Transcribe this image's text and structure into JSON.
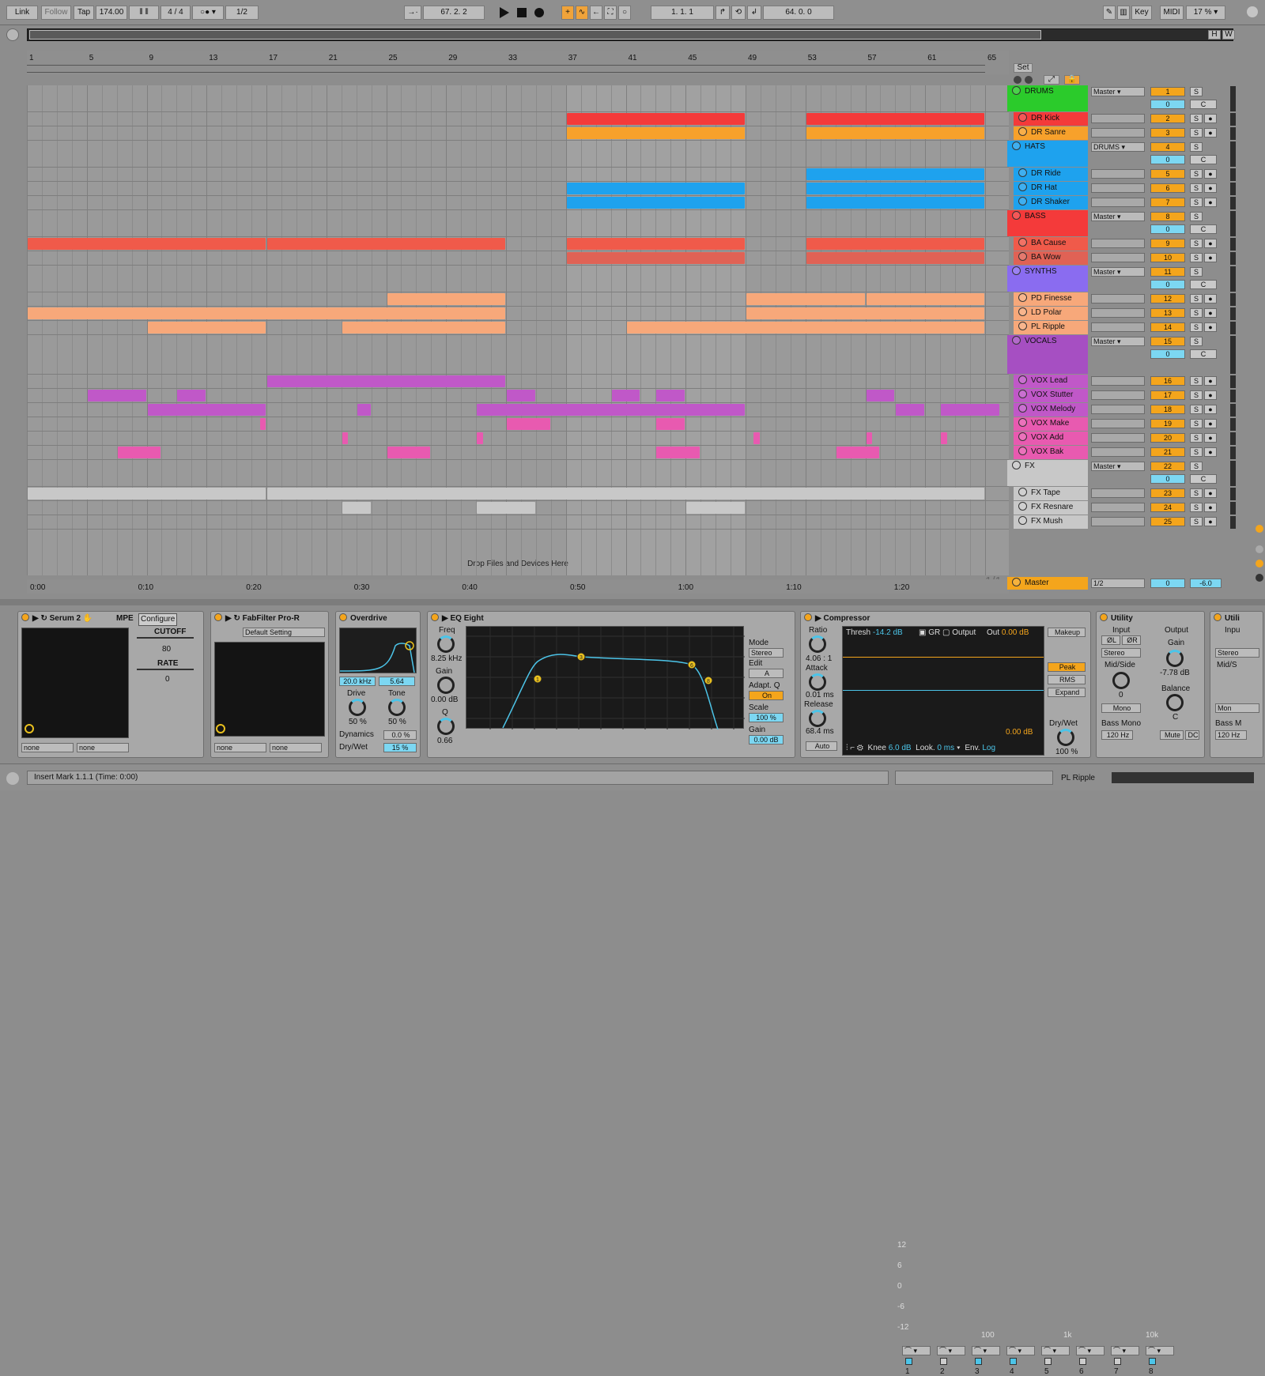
{
  "transport": {
    "link": "Link",
    "follow": "Follow",
    "tap": "Tap",
    "tempo": "174.00",
    "time_sig": "4 / 4",
    "quant": "1/2",
    "arr_pos": "67.  2.  2",
    "loop_start": "1.   1.   1",
    "loop_len": "64.   0.   0",
    "key": "Key",
    "midi": "MIDI",
    "cpu": "17 %",
    "h": "H",
    "w": "W",
    "set": "Set"
  },
  "ruler": [
    "1",
    "5",
    "9",
    "13",
    "17",
    "21",
    "25",
    "29",
    "33",
    "37",
    "41",
    "45",
    "49",
    "53",
    "57",
    "61",
    "65"
  ],
  "timeline": [
    "0:00",
    "0:10",
    "0:20",
    "0:30",
    "0:40",
    "0:50",
    "1:00",
    "1:10",
    "1:20"
  ],
  "arrangement": {
    "drop_text": "Drop Files and Devices Here",
    "page": "1/1"
  },
  "tracks": [
    {
      "name": "DRUMS",
      "color": "#2bcb2b",
      "group": true,
      "route": "Master",
      "n": "1"
    },
    {
      "name": "DR Kick",
      "color": "#f43a3a",
      "n": "2"
    },
    {
      "name": "DR Sanre",
      "color": "#f7a12b",
      "n": "3"
    },
    {
      "name": "HATS",
      "color": "#1ea2ee",
      "group": true,
      "route": "DRUMS",
      "n": "4"
    },
    {
      "name": "DR Ride",
      "color": "#1ea2ee",
      "n": "5"
    },
    {
      "name": "DR Hat",
      "color": "#1ea2ee",
      "n": "6"
    },
    {
      "name": "DR Shaker",
      "color": "#1ea2ee",
      "n": "7"
    },
    {
      "name": "BASS",
      "color": "#f43a3a",
      "group": true,
      "route": "Master",
      "n": "8"
    },
    {
      "name": "BA Cause",
      "color": "#f05a4a",
      "n": "9"
    },
    {
      "name": "BA Wow",
      "color": "#e06255",
      "n": "10"
    },
    {
      "name": "SYNTHS",
      "color": "#8a6cf0",
      "group": true,
      "route": "Master",
      "n": "11"
    },
    {
      "name": "PD Finesse",
      "color": "#f7a87a",
      "n": "12"
    },
    {
      "name": "LD Polar",
      "color": "#f7a87a",
      "n": "13"
    },
    {
      "name": "PL Ripple",
      "color": "#f7a87a",
      "n": "14"
    },
    {
      "name": "VOCALS",
      "color": "#a64fc2",
      "group": true,
      "route": "Master",
      "n": "15"
    },
    {
      "name": "VOX Lead",
      "color": "#c058c8",
      "n": "16"
    },
    {
      "name": "VOX Stutter",
      "color": "#c058c8",
      "n": "17"
    },
    {
      "name": "VOX Melody",
      "color": "#c058c8",
      "n": "18"
    },
    {
      "name": "VOX Make",
      "color": "#e85ab0",
      "n": "19"
    },
    {
      "name": "VOX Add",
      "color": "#e85ab0",
      "n": "20"
    },
    {
      "name": "VOX Bak",
      "color": "#e85ab0",
      "n": "21"
    },
    {
      "name": "FX",
      "color": "#c8c8c8",
      "group": true,
      "route": "Master",
      "n": "22"
    },
    {
      "name": "FX Tape",
      "color": "#c8c8c8",
      "n": "23"
    },
    {
      "name": "FX Resnare",
      "color": "#c8c8c8",
      "n": "24"
    },
    {
      "name": "FX Mush",
      "color": "#c8c8c8",
      "n": "25"
    }
  ],
  "master": {
    "name": "Master",
    "route": "1/2",
    "vol": "0",
    "pan": "-6.0"
  },
  "mixer_labels": {
    "solo": "S",
    "center": "C",
    "zero": "0"
  },
  "devices": {
    "serum": {
      "name": "Serum 2",
      "mpe": "MPE",
      "configure": "Configure",
      "cutoff": "CUTOFF",
      "cutoff_val": "80",
      "rate": "RATE",
      "rate_val": "0",
      "sel1": "none",
      "sel2": "none"
    },
    "fabfilter": {
      "name": "FabFilter Pro-R",
      "preset": "Default Setting",
      "sel1": "none",
      "sel2": "none"
    },
    "overdrive": {
      "name": "Overdrive",
      "freq": "20.0 kHz",
      "width": "5.64",
      "drive": "Drive",
      "drive_val": "50 %",
      "tone": "Tone",
      "tone_val": "50 %",
      "dynamics": "Dynamics",
      "dynamics_val": "0.0 %",
      "drywet": "Dry/Wet",
      "drywet_val": "15 %"
    },
    "eq": {
      "name": "EQ Eight",
      "freq": "Freq",
      "freq_val": "8.25 kHz",
      "gain": "Gain",
      "gain_val": "0.00 dB",
      "q": "Q",
      "q_val": "0.66",
      "db": [
        "12",
        "6",
        "0",
        "-6",
        "-12"
      ],
      "hz": [
        "100",
        "1k",
        "10k"
      ],
      "mode": "Mode",
      "mode_val": "Stereo",
      "edit": "Edit",
      "edit_val": "A",
      "adapt": "Adapt. Q",
      "adapt_val": "On",
      "scale": "Scale",
      "scale_val": "100 %",
      "out_gain": "Gain",
      "out_gain_val": "0.00 dB",
      "bands": [
        "1",
        "2",
        "3",
        "4",
        "5",
        "6",
        "7",
        "8"
      ]
    },
    "comp": {
      "name": "Compressor",
      "ratio": "Ratio",
      "ratio_val": "4.06 : 1",
      "attack": "Attack",
      "attack_val": "0.01 ms",
      "release": "Release",
      "release_val": "68.4 ms",
      "auto": "Auto",
      "thresh": "Thresh",
      "thresh_val": "-14.2 dB",
      "gr": "GR",
      "output": "Output",
      "out": "Out",
      "out_val": "0.00 dB",
      "meter_val": "0.00 dB",
      "knee": "Knee",
      "knee_val": "6.0 dB",
      "look": "Look.",
      "look_val": "0 ms",
      "env": "Env.",
      "env_val": "Log",
      "makeup": "Makeup",
      "peak": "Peak",
      "rms": "RMS",
      "expand": "Expand",
      "drywet": "Dry/Wet",
      "drywet_val": "100 %"
    },
    "utility": {
      "name": "Utility",
      "input": "Input",
      "output": "Output",
      "phl": "ØL",
      "phr": "ØR",
      "stereo": "Stereo",
      "gain": "Gain",
      "gain_val": "-7.78 dB",
      "midside": "Mid/Side",
      "midside_val": "0",
      "balance": "Balance",
      "balance_val": "C",
      "mono": "Mono",
      "bassmono": "Bass Mono",
      "bass_hz": "120 Hz",
      "mute": "Mute",
      "dc": "DC"
    },
    "utility2": {
      "name": "Utili",
      "input": "Inpu",
      "stereo": "Stereo",
      "midside": "Mid/S",
      "mono": "Mon",
      "bassmono": "Bass M",
      "bass_hz": "120 Hz"
    }
  },
  "status": {
    "text": "Insert Mark 1.1.1 (Time: 0:00)",
    "track": "PL Ripple"
  }
}
